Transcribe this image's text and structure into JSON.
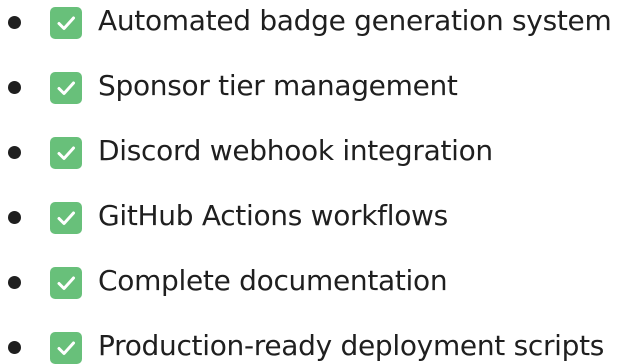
{
  "checklist": {
    "items": [
      {
        "label": "Automated badge generation system",
        "checked": true
      },
      {
        "label": "Sponsor tier management",
        "checked": true
      },
      {
        "label": "Discord webhook integration",
        "checked": true
      },
      {
        "label": "GitHub Actions workflows",
        "checked": true
      },
      {
        "label": "Complete documentation",
        "checked": true
      },
      {
        "label": "Production-ready deployment scripts",
        "checked": true
      }
    ]
  },
  "colors": {
    "check_background": "#68c07a",
    "check_mark": "#ffffff",
    "text": "#1f1f1f",
    "bullet": "#1f1f1f"
  },
  "icons": {
    "check": "white-heavy-check-mark-icon",
    "bullet": "bullet-icon"
  }
}
